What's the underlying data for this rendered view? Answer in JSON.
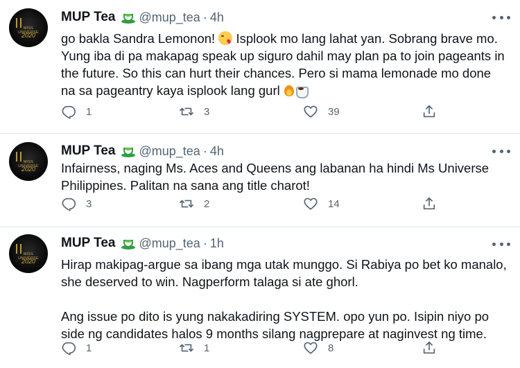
{
  "tweets": [
    {
      "name": "MUP Tea",
      "handle": "@mup_tea",
      "separator": "·",
      "time": "4h",
      "avatar_text": "MISS UNIVERSE",
      "avatar_year": "2020",
      "body_parts": [
        "go bakla Sandra Lemonon! ",
        " Isplook mo lang lahat yan. Sobrang brave mo. Yung iba di pa makapag speak up siguro dahil may plan pa to join pageants in the future. So this can hurt their chances. Pero si mama lemonade mo done na sa pageantry kaya isplook lang gurl "
      ],
      "replies": "1",
      "retweets": "3",
      "likes": "39"
    },
    {
      "name": "MUP Tea",
      "handle": "@mup_tea",
      "separator": "·",
      "time": "4h",
      "avatar_text": "MISS UNIVERSE",
      "avatar_year": "2020",
      "body": "Infairness, naging Ms. Aces and Queens ang labanan ha hindi Ms Universe Philippines. Palitan na sana ang title charot!",
      "replies": "3",
      "retweets": "2",
      "likes": "14"
    },
    {
      "name": "MUP Tea",
      "handle": "@mup_tea",
      "separator": "·",
      "time": "1h",
      "avatar_text": "MISS UNIVERSE",
      "avatar_year": "2020",
      "body_p1": "Hirap makipag-argue sa ibang mga utak munggo. Si Rabiya po bet ko manalo, she deserved to win. Nagperform talaga si ate ghorl.",
      "body_p2": "Ang issue po dito is yung nakakadiring SYSTEM. opo yun po. Isipin niyo po side ng candidates halos 9 months silang nagprepare at naginvest ng time.",
      "replies": "1",
      "retweets": "1",
      "likes": "8"
    }
  ],
  "icons": {
    "reply": "reply-icon",
    "retweet": "retweet-icon",
    "like": "heart-icon",
    "share": "share-icon",
    "more": "more-icon",
    "tea": "tea-emoji"
  },
  "colors": {
    "text": "#0f1419",
    "secondary": "#536471",
    "divider": "#e1e8ed",
    "tea_green": "#2f9e44"
  }
}
